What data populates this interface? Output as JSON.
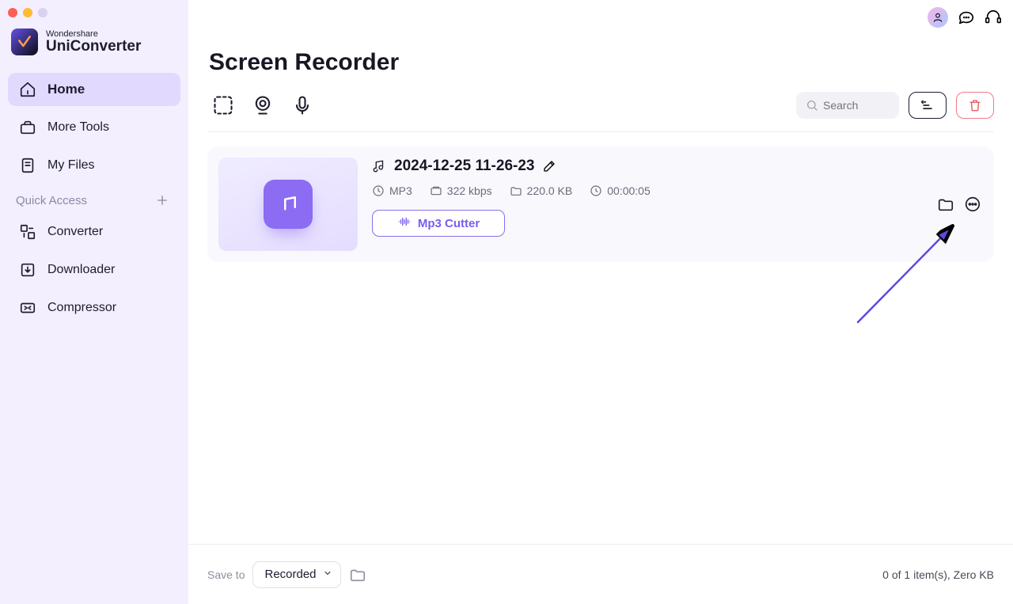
{
  "brand": {
    "sub": "Wondershare",
    "main": "UniConverter"
  },
  "sidebar": {
    "home": "Home",
    "more_tools": "More Tools",
    "my_files": "My Files",
    "quick_access_label": "Quick Access",
    "converter": "Converter",
    "downloader": "Downloader",
    "compressor": "Compressor"
  },
  "page": {
    "title": "Screen Recorder"
  },
  "search": {
    "placeholder": "Search"
  },
  "file": {
    "title": "2024-12-25 11-26-23",
    "format": "MP3",
    "bitrate": "322 kbps",
    "size": "220.0 KB",
    "duration": "00:00:05",
    "cutter_label": "Mp3 Cutter"
  },
  "footer": {
    "save_to_label": "Save to",
    "save_to_value": "Recorded",
    "status": "0 of 1 item(s), Zero KB"
  }
}
